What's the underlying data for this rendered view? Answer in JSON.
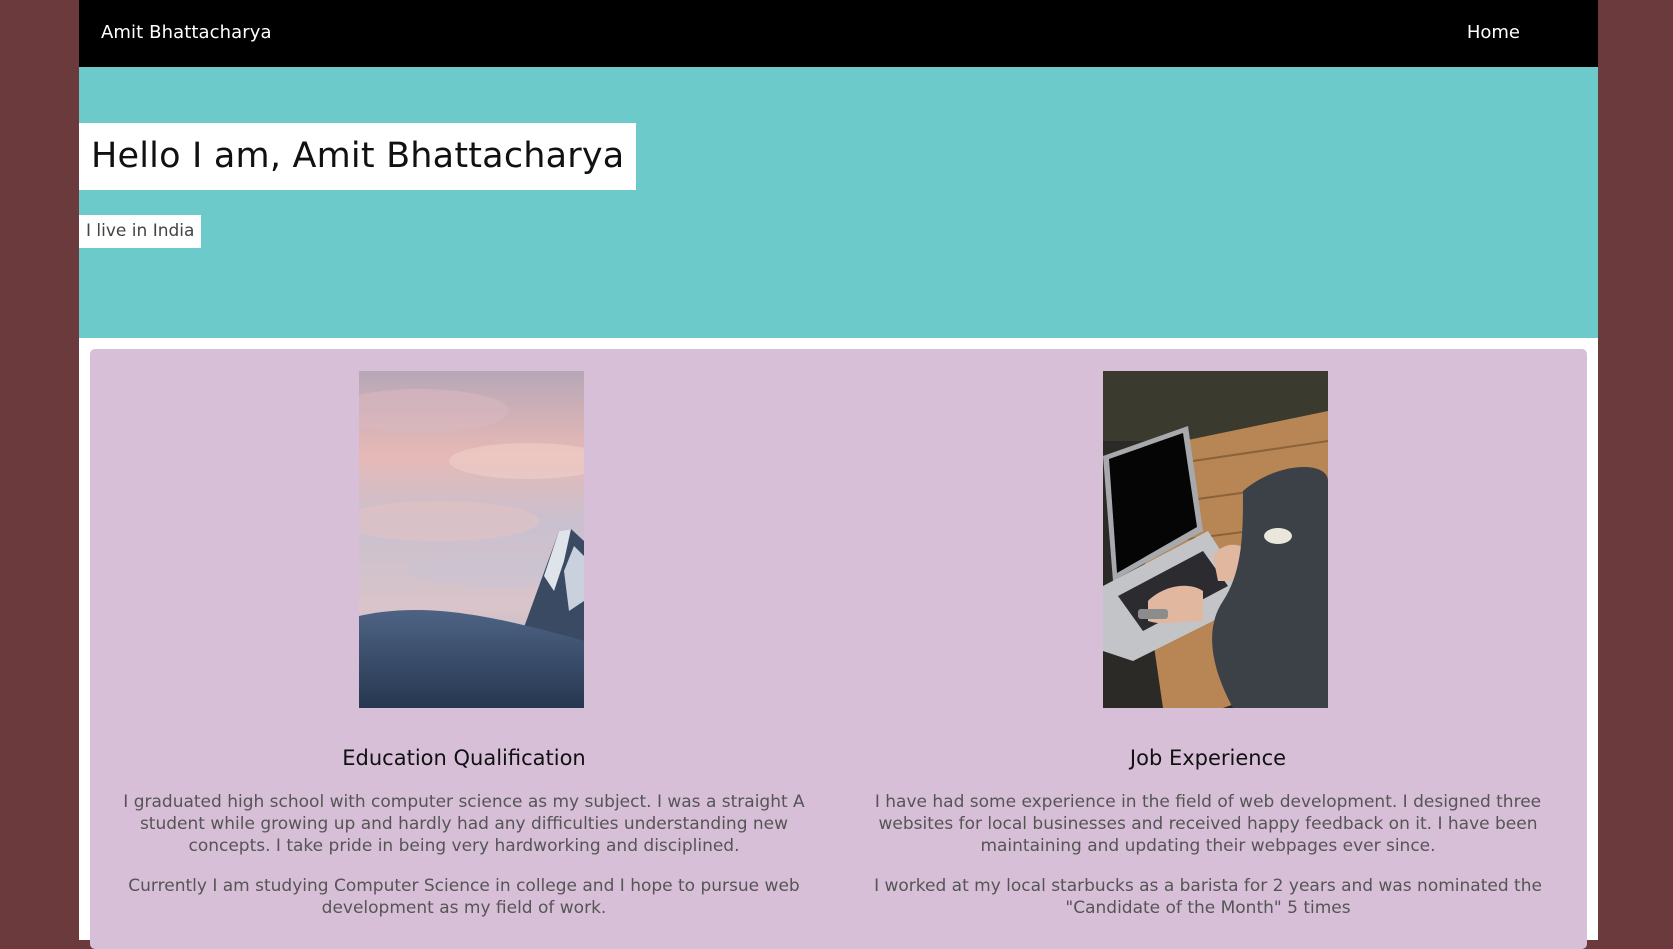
{
  "navbar": {
    "brand": "Amit Bhattacharya",
    "home_label": "Home"
  },
  "hero": {
    "title": "Hello I am, Amit Bhattacharya",
    "subtitle": "I live in India"
  },
  "education": {
    "title": "Education Qualification",
    "paragraph1": "I graduated high school with computer science as my subject. I was a straight A student while growing up and hardly had any difficulties understanding new concepts. I take pride in being very hardworking and disciplined.",
    "paragraph2": "Currently I am studying Computer Science in college and I hope to pursue web development as my field of work."
  },
  "job": {
    "title": "Job Experience",
    "paragraph1": "I have had some experience in the field of web development. I designed three websites for local businesses and received happy feedback on it. I have been maintaining and updating their webpages ever since.",
    "paragraph2": "I worked at my local starbucks as a barista for 2 years and was nominated the \"Candidate of the Month\" 5 times"
  },
  "colors": {
    "outer_background": "#6b3a3c",
    "navbar": "#000000",
    "hero_background": "#6ccaca",
    "content_background": "#d8bfd8"
  }
}
